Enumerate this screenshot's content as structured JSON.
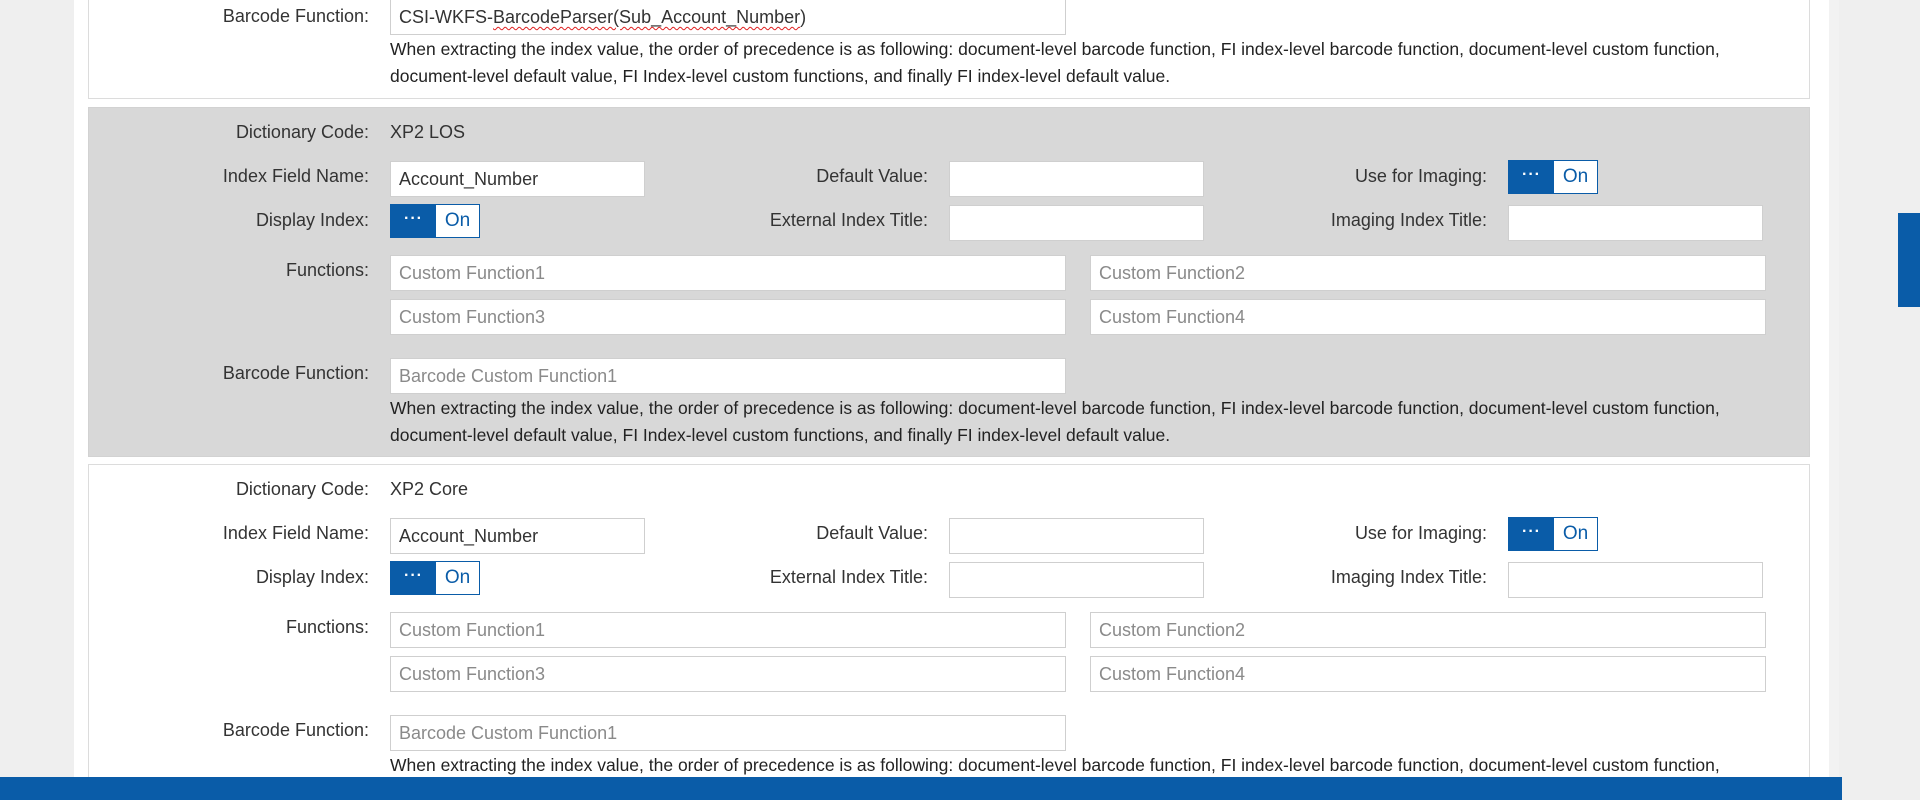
{
  "labels": {
    "dictionary_code": "Dictionary Code:",
    "index_field_name": "Index Field Name:",
    "default_value": "Default Value:",
    "use_for_imaging": "Use for Imaging:",
    "display_index": "Display Index:",
    "external_index_title": "External Index Title:",
    "imaging_index_title": "Imaging Index Title:",
    "functions": "Functions:",
    "barcode_function": "Barcode Function:"
  },
  "toggle": {
    "knob": "···",
    "on_label": "On"
  },
  "placeholders": {
    "custom_function1": "Custom Function1",
    "custom_function2": "Custom Function2",
    "custom_function3": "Custom Function3",
    "custom_function4": "Custom Function4",
    "barcode_custom_function1": "Barcode Custom Function1"
  },
  "precedence_note_line1": "When extracting the index value, the order of precedence is as following: document-level barcode function, FI index-level barcode function, document-level custom function,",
  "precedence_note_line2": "document-level default value, FI Index-level custom functions, and finally FI index-level default value.",
  "blocks": [
    {
      "barcode_function_prefix": "CSI-WKFS-",
      "barcode_function_misspelled": "BarcodeParser(Sub_Account_Number",
      "barcode_function_suffix": ")"
    },
    {
      "dictionary_code": "XP2 LOS",
      "index_field_name": "Account_Number",
      "default_value": "",
      "use_for_imaging": "On",
      "display_index": "On",
      "external_index_title": "",
      "imaging_index_title": "",
      "selected": true
    },
    {
      "dictionary_code": "XP2 Core",
      "index_field_name": "Account_Number",
      "default_value": "",
      "use_for_imaging": "On",
      "display_index": "On",
      "external_index_title": "",
      "imaging_index_title": "",
      "selected": false
    }
  ],
  "colors": {
    "accent": "#0a5ca8",
    "selected_row": "#d8d8d8",
    "page": "#efefef"
  }
}
